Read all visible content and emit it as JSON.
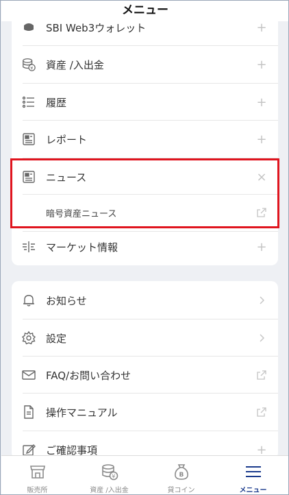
{
  "header": {
    "title": "メニュー"
  },
  "card1": {
    "items": [
      {
        "label": "SBI Web3ウォレット",
        "icon": "wallet-icon",
        "action": "+"
      },
      {
        "label": "資産 /入出金",
        "icon": "coins-icon",
        "action": "+"
      },
      {
        "label": "履歴",
        "icon": "list-icon",
        "action": "+"
      },
      {
        "label": "レポート",
        "icon": "report-icon",
        "action": "+"
      },
      {
        "label": "ニュース",
        "icon": "news-icon",
        "action": "×"
      },
      {
        "label": "暗号資産ニュース",
        "icon": "",
        "action": "external-link-icon"
      },
      {
        "label": "マーケット情報",
        "icon": "market-icon",
        "action": "+"
      }
    ]
  },
  "card2": {
    "items": [
      {
        "label": "お知らせ",
        "icon": "bell-icon",
        "action": "chevron-right-icon"
      },
      {
        "label": "設定",
        "icon": "gear-icon",
        "action": "chevron-right-icon"
      },
      {
        "label": "FAQ/お問い合わせ",
        "icon": "mail-icon",
        "action": "external-link-icon"
      },
      {
        "label": "操作マニュアル",
        "icon": "document-icon",
        "action": "external-link-icon"
      },
      {
        "label": "ご確認事項",
        "icon": "edit-icon",
        "action": "+"
      }
    ]
  },
  "tabbar": {
    "tabs": [
      {
        "label": "販売所",
        "icon": "store-icon"
      },
      {
        "label": "資産 /入出金",
        "icon": "coins-icon"
      },
      {
        "label": "貸コイン",
        "icon": "bitcoin-bag-icon"
      },
      {
        "label": "メニュー",
        "icon": "hamburger-icon"
      }
    ],
    "active": "メニュー"
  },
  "colors": {
    "highlight": "#e0141e",
    "active_tab": "#1a3a8c",
    "background": "#eef0f4"
  }
}
